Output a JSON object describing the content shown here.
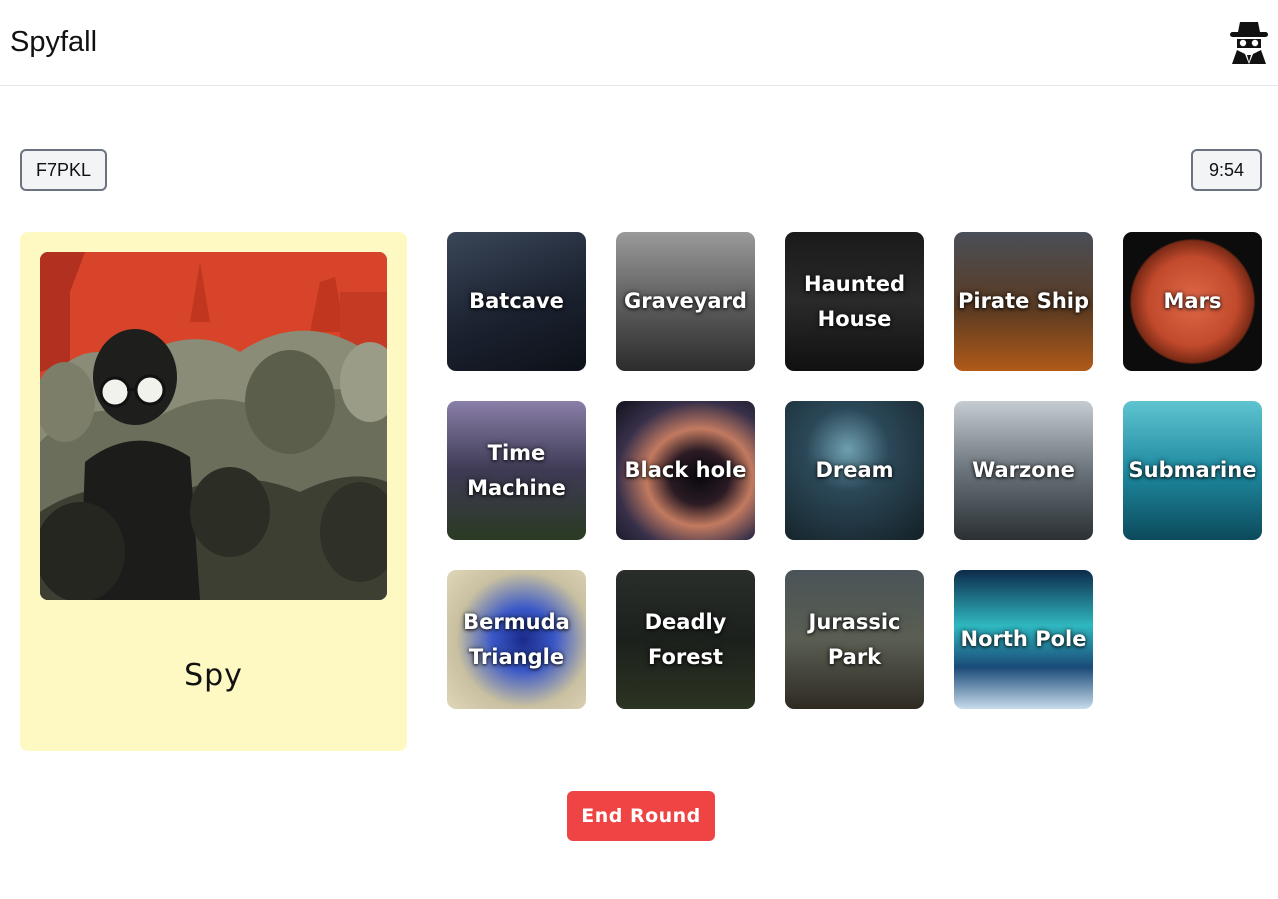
{
  "header": {
    "title": "Spyfall",
    "logo_icon": "spy-icon"
  },
  "game": {
    "room_code": "F7PKL",
    "timer": "9:54"
  },
  "role": {
    "label": "Spy",
    "image": "spy-crowd-illustration"
  },
  "locations": [
    {
      "name": "Batcave",
      "bg": "linear-gradient(160deg,#3a4658 0%,#1b2230 55%,#0d1118 100%)"
    },
    {
      "name": "Graveyard",
      "bg": "linear-gradient(180deg,#9a9a9a 0%,#5f5f5f 50%,#2c2c2c 100%)"
    },
    {
      "name": "Haunted\nHouse",
      "bg": "linear-gradient(180deg,#1a1a1a 0%,#2a2a2a 50%,#101010 100%)"
    },
    {
      "name": "Pirate Ship",
      "bg": "linear-gradient(180deg,#4a4f58 0%,#5a3a22 55%,#b05a18 100%)"
    },
    {
      "name": "Mars",
      "bg": "radial-gradient(circle at 50% 50%,#e0694a 0%,#c24a2c 45%,#7a2a16 62%,#0c0c0c 64%)"
    },
    {
      "name": "Time\nMachine",
      "bg": "linear-gradient(180deg,#8a7fa8 0%,#3e3a55 50%,#2a3a22 100%)"
    },
    {
      "name": "Black hole",
      "bg": "radial-gradient(ellipse at 60% 55%,#0a0a10 0%,#2b1b24 25%,#c27a60 45%,#38304a 70%,#12121e 100%)"
    },
    {
      "name": "Dream",
      "bg": "radial-gradient(circle at 45% 35%,#6fa0b0 0%,#2b4858 35%,#142026 100%)"
    },
    {
      "name": "Warzone",
      "bg": "linear-gradient(180deg,#c5ccd2 0%,#6b747a 50%,#2a3034 100%)"
    },
    {
      "name": "Submarine",
      "bg": "linear-gradient(180deg,#5fc4d0 0%,#1f8aa0 50%,#0c4a5c 100%)"
    },
    {
      "name": "Bermuda\nTriangle",
      "bg": "radial-gradient(circle at 55% 50%,#1a2a8a 0%,#3a58c8 30%,#c8c0a0 65%,#e0d6b8 100%)"
    },
    {
      "name": "Deadly\nForest",
      "bg": "linear-gradient(180deg,#2a2e2a 0%,#1c201c 50%,#2c3422 100%)"
    },
    {
      "name": "Jurassic Park",
      "bg": "linear-gradient(180deg,#4a5458 0%,#5a5e52 50%,#2e2a22 100%)"
    },
    {
      "name": "North Pole",
      "bg": "linear-gradient(180deg,#0d2a4a 0%,#2fb8c0 40%,#1a4a78 70%,#c8dceb 100%)"
    }
  ],
  "actions": {
    "end_round": "End Round"
  }
}
